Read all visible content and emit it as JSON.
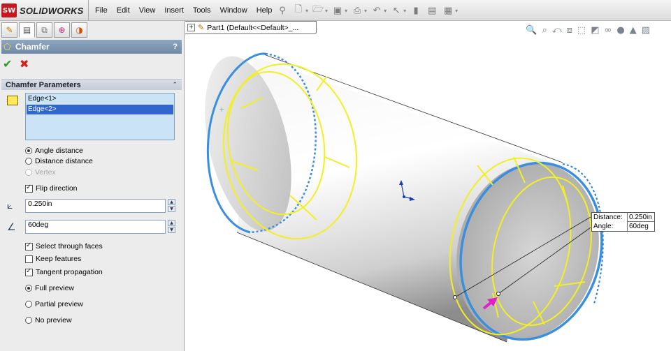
{
  "app": {
    "logo_mark": "SW",
    "logo_text": "SOLIDWORKS"
  },
  "menu": [
    "File",
    "Edit",
    "View",
    "Insert",
    "Tools",
    "Window",
    "Help"
  ],
  "property_manager": {
    "title": "Chamfer",
    "help": "?",
    "group_title": "Chamfer Parameters",
    "edges": [
      "Edge<1>",
      "Edge<2>"
    ],
    "selected_edge_index": 1,
    "options": {
      "angle_distance": "Angle distance",
      "distance_distance": "Distance distance",
      "vertex": "Vertex"
    },
    "flip_direction": "Flip direction",
    "distance_value": "0.250in",
    "angle_value": "60deg",
    "select_through_faces": "Select through faces",
    "keep_features": "Keep features",
    "tangent_propagation": "Tangent propagation",
    "preview": {
      "full": "Full preview",
      "partial": "Partial preview",
      "none": "No preview"
    }
  },
  "viewport": {
    "tree_label": "Part1  (Default<<Default>_...",
    "tree_expand": "+",
    "callout": {
      "distance_label": "Distance:",
      "distance_value": "0.250in",
      "angle_label": "Angle:",
      "angle_value": "60deg"
    }
  },
  "colors": {
    "edge_highlight": "#3a8ee0",
    "preview_yellow": "#f2ef22",
    "header_blue": "#7690ad",
    "selection": "#3366cc"
  }
}
